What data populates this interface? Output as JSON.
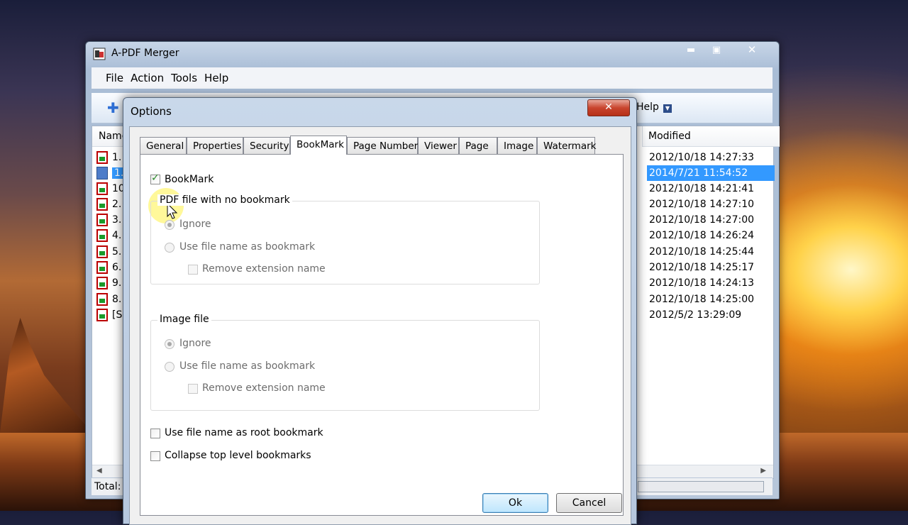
{
  "main_window": {
    "title": "A-PDF Merger",
    "controls": {
      "minimize": "▬",
      "maximize": "▣",
      "close": "✕"
    },
    "menu": [
      "File",
      "Action",
      "Tools",
      "Help"
    ],
    "toolbar": {
      "help_label": "Help",
      "dropdown_glyph": "▼"
    },
    "columns": {
      "name": "Name",
      "modified": "Modified"
    },
    "left_rows": [
      "1.",
      "1.",
      "10",
      "2.",
      "3.",
      "4.",
      "5.",
      "6.",
      "9.",
      "8.",
      "[S"
    ],
    "modified": [
      "2012/10/18 14:27:33",
      "2014/7/21 11:54:52",
      "2012/10/18 14:21:41",
      "2012/10/18 14:27:10",
      "2012/10/18 14:27:00",
      "2012/10/18 14:26:24",
      "2012/10/18 14:25:44",
      "2012/10/18 14:25:17",
      "2012/10/18 14:24:13",
      "2012/10/18 14:25:00",
      "2012/5/2 13:29:09"
    ],
    "selected_row": 1,
    "status_label": "Total:"
  },
  "dialog": {
    "title": "Options",
    "close_glyph": "✕",
    "tabs": [
      "General",
      "Properties",
      "Security",
      "BookMark",
      "Page Number",
      "Viewer",
      "Page",
      "Image",
      "Watermark"
    ],
    "active_tab": "BookMark",
    "bookmark_checkbox": {
      "label": "BookMark",
      "checked": true
    },
    "pdf_group": {
      "title": "PDF file with no bookmark",
      "option_ignore": "Ignore",
      "option_use_name": "Use file name as bookmark",
      "remove_ext": "Remove extension name"
    },
    "image_group": {
      "title": "Image file",
      "option_ignore": "Ignore",
      "option_use_name": "Use file name as bookmark",
      "remove_ext": "Remove extension name"
    },
    "root_bookmark": "Use file name as root bookmark",
    "collapse_top": "Collapse top level bookmarks",
    "ok": "Ok",
    "cancel": "Cancel"
  },
  "colors": {
    "selection": "#3399ff",
    "close_red": "#c9452e"
  }
}
